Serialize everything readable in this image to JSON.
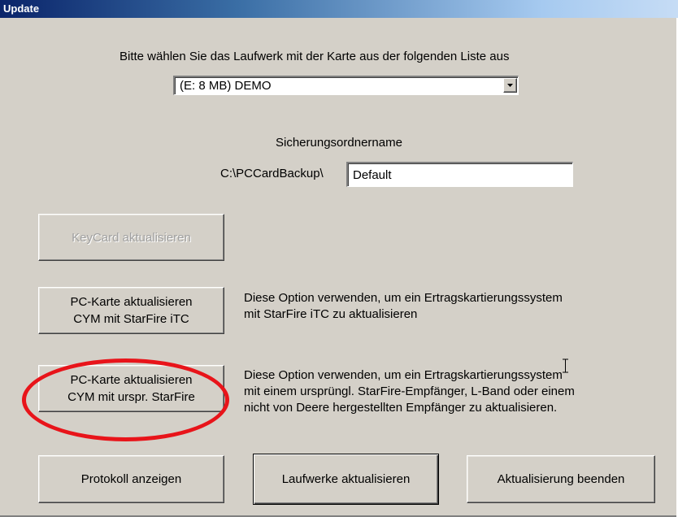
{
  "window": {
    "title": "Update"
  },
  "drive": {
    "prompt": "Bitte wählen Sie das Laufwerk mit der Karte aus der folgenden Liste aus",
    "selected": "(E: 8 MB) DEMO"
  },
  "backup": {
    "heading": "Sicherungsordnername",
    "prefix": "C:\\PCCardBackup\\",
    "value": "Default"
  },
  "buttons": {
    "keycard": "KeyCard aktualisieren",
    "itc_line1": "PC-Karte aktualisieren",
    "itc_line2": "CYM mit StarFire iTC",
    "orig_line1": "PC-Karte aktualisieren",
    "orig_line2": "CYM mit urspr. StarFire",
    "show_log": "Protokoll anzeigen",
    "update_drives": "Laufwerke aktualisieren",
    "finish": "Aktualisierung beenden"
  },
  "descriptions": {
    "itc": [
      "Diese Option verwenden, um ein Ertragskartierungssystem",
      "mit StarFire iTC zu aktualisieren"
    ],
    "orig": [
      "Diese Option verwenden, um ein Ertragskartierungssystem",
      "mit einem ursprüngl. StarFire-Empfänger, L-Band oder einem",
      "nicht von Deere hergestellten Empfänger zu aktualisieren."
    ]
  },
  "colors": {
    "titlebar_start": "#0a246a",
    "dialog_bg": "#d4d0c8",
    "highlight": "#e8141a"
  },
  "icons": {
    "dropdown_arrow": "chevron-down-icon",
    "cursor": "text-cursor-icon"
  }
}
